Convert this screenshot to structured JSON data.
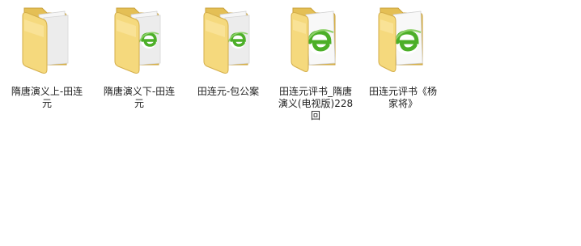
{
  "window": {
    "view": "large-icons"
  },
  "colors": {
    "background": "#ffffff",
    "folder_back": "#e6c45f",
    "folder_front": "#f7dd86",
    "paper": "#f4f4f4",
    "ie_green": "#4caf28",
    "label_text": "#1e1e1e"
  },
  "items": [
    {
      "icon": "folder-icon",
      "content": "blank-pages",
      "label_lines": [
        "隋唐演义上-田连",
        "元"
      ]
    },
    {
      "icon": "folder-icon",
      "content": "ie-document",
      "label_lines": [
        "隋唐演义下-田连",
        "元"
      ]
    },
    {
      "icon": "folder-icon",
      "content": "ie-document",
      "label_lines": [
        "田连元-包公案"
      ]
    },
    {
      "icon": "folder-icon",
      "content": "ie-document",
      "label_lines": [
        "田连元评书_隋唐",
        "演义(电视版)228",
        "回"
      ]
    },
    {
      "icon": "folder-icon",
      "content": "ie-document",
      "label_lines": [
        "田连元评书《杨",
        "家将》"
      ]
    }
  ]
}
